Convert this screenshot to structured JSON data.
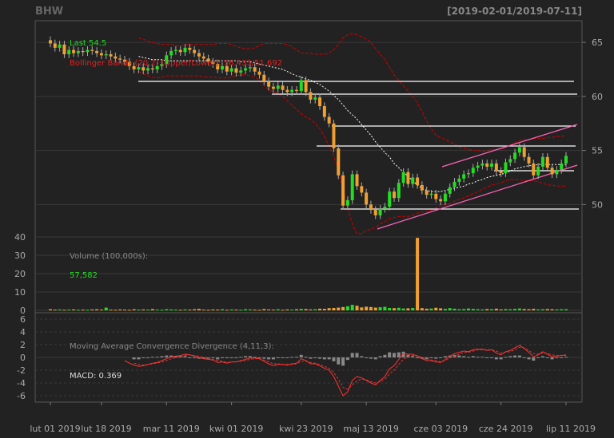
{
  "header": {
    "symbol": "BHW",
    "date_range": "[2019-02-01/2019-07-11]"
  },
  "colors": {
    "background": "#222222",
    "panel_border": "#555555",
    "grid": "#3a3a3a",
    "up": "#22dd22",
    "down": "#f0a030",
    "neutral": "#888888",
    "bands": "#cc0000",
    "sma": "#ffffff",
    "text": "#aaaaaa",
    "macd_line": "#ff3333"
  },
  "chart_data": [
    {
      "type": "candlestick",
      "panel": "price",
      "annotations": {
        "last": "Last 54.5",
        "bbands": "Bollinger Bands (20,2) [Upper/Lower]: 56.435/51.692"
      },
      "yticks": [
        50,
        55,
        60,
        65
      ],
      "ylim": [
        47,
        67
      ],
      "x_labels": [
        "lut 01 2019",
        "lut 18 2019",
        "mar 11 2019",
        "kwi 01 2019",
        "kwi 23 2019",
        "maj 13 2019",
        "cze 03 2019",
        "cze 24 2019",
        "lip 11 2019"
      ],
      "x_label_index": [
        0,
        11,
        25,
        39,
        54,
        68,
        83,
        97,
        111
      ],
      "n_bars": 112,
      "close": [
        64.9,
        64.5,
        64.8,
        63.9,
        64.3,
        64.0,
        64.2,
        64.1,
        64.3,
        64.2,
        64.0,
        63.8,
        63.9,
        63.7,
        63.5,
        63.4,
        63.2,
        62.8,
        62.5,
        62.7,
        62.4,
        62.6,
        62.5,
        62.8,
        63.0,
        63.8,
        64.2,
        64.3,
        64.1,
        64.5,
        64.3,
        64.0,
        63.7,
        63.5,
        63.2,
        63.0,
        62.5,
        62.8,
        62.3,
        62.6,
        62.2,
        62.4,
        62.6,
        62.7,
        62.3,
        62.0,
        61.4,
        60.9,
        60.7,
        61.0,
        60.6,
        60.4,
        60.6,
        60.5,
        61.5,
        60.4,
        59.7,
        59.9,
        59.1,
        58.1,
        57.5,
        55.2,
        52.7,
        49.9,
        50.4,
        52.8,
        51.7,
        51.1,
        50.0,
        49.5,
        49.0,
        49.6,
        49.8,
        51.2,
        50.6,
        52.0,
        53.0,
        51.9,
        52.5,
        51.8,
        51.3,
        50.9,
        51.0,
        50.5,
        50.3,
        51.0,
        51.6,
        52.1,
        52.4,
        52.8,
        52.9,
        53.4,
        53.6,
        53.8,
        53.5,
        53.8,
        53.1,
        52.9,
        53.9,
        54.2,
        54.8,
        55.3,
        54.4,
        53.8,
        52.7,
        53.5,
        54.4,
        53.4,
        52.8,
        53.2,
        53.8,
        54.5
      ],
      "sma": [
        null,
        null,
        null,
        null,
        null,
        null,
        null,
        null,
        null,
        null,
        null,
        null,
        null,
        null,
        null,
        null,
        null,
        null,
        null,
        63.7,
        63.6,
        63.5,
        63.4,
        63.4,
        63.4,
        63.3,
        63.3,
        63.3,
        63.3,
        63.3,
        63.3,
        63.3,
        63.3,
        63.3,
        63.3,
        63.3,
        63.3,
        63.3,
        63.3,
        63.3,
        63.3,
        63.2,
        63.2,
        63.2,
        63.1,
        63.0,
        62.9,
        62.8,
        62.7,
        62.6,
        62.5,
        62.3,
        62.1,
        61.9,
        61.8,
        61.6,
        61.5,
        61.3,
        61.1,
        60.8,
        60.5,
        60.1,
        59.7,
        59.2,
        58.7,
        58.3,
        57.9,
        57.4,
        56.9,
        56.4,
        55.8,
        55.3,
        54.8,
        54.4,
        53.8,
        53.4,
        53.0,
        52.6,
        52.2,
        51.8,
        51.5,
        51.3,
        51.2,
        51.2,
        51.2,
        51.3,
        51.4,
        51.5,
        51.6,
        51.7,
        51.9,
        52.0,
        52.2,
        52.3,
        52.5,
        52.6,
        52.7,
        52.8,
        52.9,
        53.1,
        53.3,
        53.4,
        53.5,
        53.6,
        53.6,
        53.7,
        53.7,
        53.7,
        53.7,
        53.7,
        53.7,
        53.7
      ],
      "bb_upper": [
        null,
        null,
        null,
        null,
        null,
        null,
        null,
        null,
        null,
        null,
        null,
        null,
        null,
        null,
        null,
        null,
        null,
        null,
        null,
        65.4,
        65.3,
        65.1,
        65.0,
        64.9,
        64.8,
        64.8,
        64.8,
        64.7,
        64.7,
        64.8,
        64.8,
        64.8,
        64.8,
        64.8,
        64.8,
        64.8,
        64.9,
        64.9,
        64.9,
        64.8,
        64.6,
        64.5,
        64.4,
        64.4,
        64.5,
        64.7,
        64.9,
        64.9,
        64.9,
        64.9,
        64.9,
        64.8,
        64.6,
        64.3,
        64.0,
        64.0,
        64.0,
        63.9,
        63.9,
        63.9,
        64.0,
        64.3,
        64.8,
        65.4,
        65.7,
        65.8,
        65.7,
        65.5,
        65.3,
        65.0,
        64.4,
        63.9,
        63.4,
        62.7,
        62.0,
        61.5,
        61.0,
        60.5,
        60.0,
        59.4,
        58.6,
        57.7,
        57.0,
        56.4,
        56.2,
        56.0,
        55.8,
        55.6,
        55.3,
        55.2,
        55.1,
        55.0,
        55.0,
        54.9,
        55.0,
        55.1,
        55.1,
        55.1,
        55.3,
        55.5,
        55.7,
        55.9,
        56.0,
        56.0,
        56.1,
        56.1,
        56.1,
        56.2,
        56.2,
        56.3,
        56.3,
        56.4
      ],
      "bb_lower": [
        null,
        null,
        null,
        null,
        null,
        null,
        null,
        null,
        null,
        null,
        null,
        null,
        null,
        null,
        null,
        null,
        null,
        null,
        null,
        62.3,
        62.1,
        61.9,
        61.8,
        61.7,
        61.8,
        61.9,
        61.9,
        61.9,
        61.9,
        61.9,
        61.9,
        61.9,
        61.9,
        61.8,
        61.8,
        61.8,
        61.7,
        61.7,
        61.7,
        61.8,
        61.9,
        62.0,
        62.0,
        61.9,
        61.8,
        61.5,
        61.0,
        60.6,
        60.4,
        60.3,
        60.0,
        59.6,
        59.2,
        58.8,
        58.4,
        58.1,
        57.9,
        57.5,
        57.0,
        56.3,
        55.4,
        54.5,
        53.2,
        51.4,
        49.6,
        48.2,
        47.3,
        47.3,
        47.6,
        47.7,
        47.9,
        48.2,
        48.4,
        48.7,
        48.8,
        48.9,
        48.9,
        48.9,
        49.0,
        49.2,
        49.3,
        49.4,
        49.5,
        49.7,
        49.9,
        50.0,
        50.1,
        50.3,
        50.5,
        50.6,
        50.8,
        51.0,
        51.2,
        51.4,
        51.6,
        51.8,
        51.9,
        52.0,
        52.2,
        52.3,
        52.3,
        52.3,
        52.2,
        52.2,
        52.2,
        52.1,
        52.0,
        51.8,
        51.8,
        51.7,
        51.7,
        51.7
      ]
    },
    {
      "type": "bar",
      "panel": "volume",
      "title": "Volume (100,000s):",
      "last_value": "57,582",
      "yticks": [
        0,
        10,
        20,
        30,
        40
      ],
      "ylim": [
        0,
        40
      ],
      "values": [
        0.6,
        0.4,
        0.5,
        0.3,
        0.4,
        0.5,
        0.3,
        0.4,
        0.3,
        0.5,
        0.6,
        0.4,
        1.5,
        0.4,
        0.3,
        0.5,
        0.4,
        0.3,
        0.6,
        0.4,
        0.5,
        0.4,
        0.7,
        0.4,
        0.3,
        0.6,
        0.5,
        0.4,
        0.3,
        0.5,
        0.4,
        0.6,
        0.8,
        0.4,
        0.3,
        0.5,
        0.4,
        0.6,
        0.3,
        0.5,
        0.4,
        0.3,
        0.6,
        0.5,
        0.4,
        0.3,
        0.7,
        0.5,
        0.4,
        0.6,
        0.3,
        0.5,
        0.4,
        0.6,
        0.8,
        0.7,
        0.5,
        0.6,
        0.9,
        0.8,
        1.2,
        1.3,
        1.5,
        1.8,
        2.2,
        3.0,
        2.5,
        1.6,
        2.0,
        1.8,
        1.5,
        1.7,
        1.9,
        1.3,
        1.2,
        1.4,
        1.0,
        1.1,
        1.3,
        39.5,
        1.2,
        0.9,
        1.0,
        1.4,
        1.1,
        0.8,
        1.2,
        0.9,
        0.6,
        0.7,
        1.0,
        0.8,
        0.6,
        0.5,
        0.7,
        0.6,
        0.9,
        0.5,
        0.7,
        0.6,
        0.8,
        1.0,
        0.7,
        0.6,
        0.8,
        0.5,
        0.6,
        0.7,
        0.6,
        0.5,
        0.6,
        0.6
      ]
    },
    {
      "type": "macd",
      "panel": "macd",
      "title": "Moving Average Convergence Divergence (4,11,3):",
      "last_value": "MACD: 0.369",
      "yticks": [
        -6,
        -4,
        -2,
        0,
        2,
        4,
        6
      ],
      "ylim": [
        -7,
        7
      ],
      "macd": [
        null,
        null,
        null,
        null,
        null,
        null,
        null,
        null,
        null,
        null,
        null,
        null,
        null,
        null,
        null,
        null,
        -0.5,
        -0.9,
        -1.2,
        -1.4,
        -1.3,
        -1.1,
        -0.9,
        -0.8,
        -0.5,
        -0.2,
        0.1,
        0.2,
        0.3,
        0.5,
        0.4,
        0.2,
        0.0,
        -0.2,
        -0.3,
        -0.4,
        -0.8,
        -0.7,
        -0.9,
        -0.7,
        -0.7,
        -0.5,
        -0.3,
        -0.1,
        -0.1,
        -0.2,
        -0.6,
        -1.0,
        -1.3,
        -1.1,
        -1.1,
        -1.2,
        -1.0,
        -0.9,
        -0.2,
        -0.5,
        -1.0,
        -1.0,
        -1.3,
        -1.7,
        -2.0,
        -3.0,
        -4.5,
        -6.0,
        -5.4,
        -3.6,
        -3.0,
        -3.2,
        -3.6,
        -4.0,
        -4.3,
        -3.6,
        -3.0,
        -1.8,
        -1.3,
        -0.3,
        0.6,
        0.5,
        0.5,
        0.2,
        -0.2,
        -0.5,
        -0.5,
        -0.7,
        -0.8,
        -0.3,
        0.2,
        0.6,
        0.8,
        1.0,
        0.9,
        1.2,
        1.3,
        1.3,
        1.1,
        1.2,
        0.7,
        0.4,
        0.9,
        1.1,
        1.5,
        1.9,
        1.4,
        0.8,
        0.1,
        0.4,
        0.9,
        0.5,
        0.1,
        0.2,
        0.3,
        0.4
      ],
      "signal": [
        null,
        null,
        null,
        null,
        null,
        null,
        null,
        null,
        null,
        null,
        null,
        null,
        null,
        null,
        null,
        null,
        null,
        null,
        -0.9,
        -1.1,
        -1.2,
        -1.1,
        -1.0,
        -0.9,
        -0.7,
        -0.5,
        -0.2,
        0.0,
        0.1,
        0.3,
        0.4,
        0.3,
        0.2,
        0.0,
        -0.1,
        -0.3,
        -0.5,
        -0.6,
        -0.8,
        -0.7,
        -0.7,
        -0.6,
        -0.5,
        -0.3,
        -0.2,
        -0.2,
        -0.4,
        -0.7,
        -1.0,
        -1.0,
        -1.1,
        -1.1,
        -1.1,
        -1.0,
        -0.6,
        -0.6,
        -0.8,
        -0.9,
        -1.1,
        -1.4,
        -1.7,
        -2.4,
        -3.4,
        -4.7,
        -5.0,
        -4.3,
        -3.7,
        -3.4,
        -3.5,
        -3.8,
        -4.0,
        -3.8,
        -3.4,
        -2.6,
        -2.0,
        -1.1,
        -0.3,
        0.1,
        0.3,
        0.3,
        0.0,
        -0.2,
        -0.4,
        -0.5,
        -0.7,
        -0.5,
        -0.1,
        0.2,
        0.5,
        0.8,
        0.8,
        1.0,
        1.2,
        1.2,
        1.2,
        1.2,
        1.0,
        0.7,
        0.8,
        0.9,
        1.2,
        1.6,
        1.5,
        1.1,
        0.6,
        0.5,
        0.7,
        0.6,
        0.4,
        0.3,
        0.3,
        0.3
      ]
    }
  ]
}
